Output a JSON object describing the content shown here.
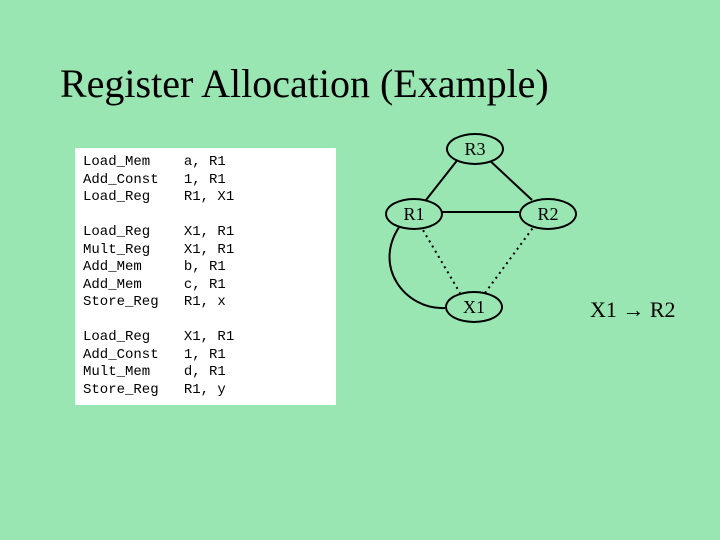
{
  "title": "Register Allocation (Example)",
  "code": {
    "block1": [
      [
        "Load_Mem",
        "a, R1"
      ],
      [
        "Add_Const",
        "1, R1"
      ],
      [
        "Load_Reg",
        "R1, X1"
      ]
    ],
    "block2": [
      [
        "Load_Reg",
        "X1, R1"
      ],
      [
        "Mult_Reg",
        "X1, R1"
      ],
      [
        "Add_Mem",
        "b, R1"
      ],
      [
        "Add_Mem",
        "c, R1"
      ],
      [
        "Store_Reg",
        "R1, x"
      ]
    ],
    "block3": [
      [
        "Load_Reg",
        "X1, R1"
      ],
      [
        "Add_Const",
        "1, R1"
      ],
      [
        "Mult_Mem",
        "d, R1"
      ],
      [
        "Store_Reg",
        "R1, y"
      ]
    ]
  },
  "graph": {
    "nodes": {
      "R3": "R3",
      "R1": "R1",
      "R2": "R2",
      "X1": "X1"
    },
    "assignment": "X1 → R2"
  }
}
